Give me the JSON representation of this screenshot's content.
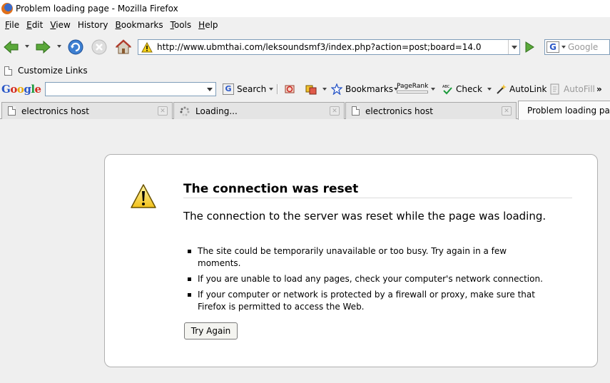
{
  "window": {
    "title": "Problem loading page - Mozilla Firefox"
  },
  "menu": [
    {
      "label": "File",
      "key": "F",
      "rest": "ile"
    },
    {
      "label": "Edit",
      "key": "E",
      "rest": "dit"
    },
    {
      "label": "View",
      "key": "V",
      "rest": "iew"
    },
    {
      "label": "History",
      "key": "",
      "rest": "History"
    },
    {
      "label": "Bookmarks",
      "key": "B",
      "rest": "ookmarks"
    },
    {
      "label": "Tools",
      "key": "T",
      "rest": "ools"
    },
    {
      "label": "Help",
      "key": "H",
      "rest": "elp"
    }
  ],
  "navbar": {
    "url": "http://www.ubmthai.com/leksoundsmf3/index.php?action=post;board=14.0",
    "search_placeholder": "Google"
  },
  "links_toolbar": {
    "label": "Customize Links"
  },
  "google_toolbar": {
    "search_label": "Search",
    "bookmarks_label": "Bookmarks",
    "pagerank_label": "PageRank",
    "check_label": "Check",
    "autolink_label": "AutoLink",
    "autofill_label": "AutoFill",
    "more_label": "»"
  },
  "tabs": [
    {
      "label": "electronics host"
    },
    {
      "label": "Loading..."
    },
    {
      "label": "electronics host"
    },
    {
      "label": "Problem loading page"
    }
  ],
  "error": {
    "title": "The connection was reset",
    "description": "The connection to the server was reset while the page was loading.",
    "bullets": [
      "The site could be temporarily unavailable or too busy. Try again in a few moments.",
      "If you are unable to load any pages, check your computer's network connection.",
      "If your computer or network is protected by a firewall or proxy, make sure that Firefox is permitted to access the Web."
    ],
    "button_label": "Try Again"
  }
}
